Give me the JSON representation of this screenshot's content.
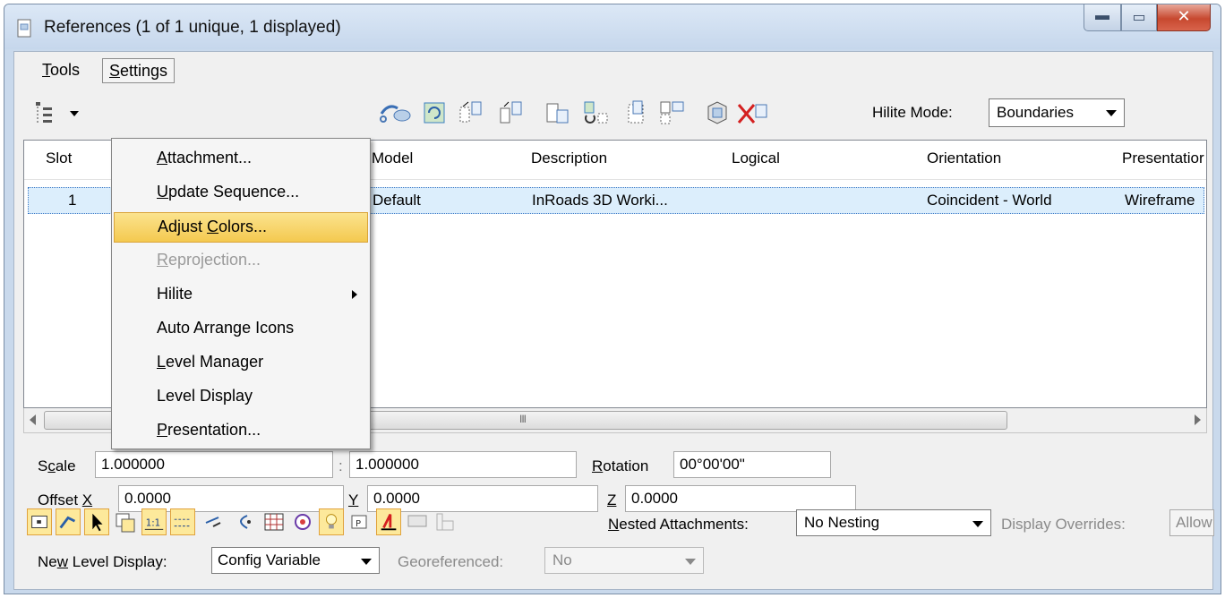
{
  "window": {
    "title": "References (1 of 1 unique, 1 displayed)"
  },
  "menubar": {
    "tools": "Tools",
    "settings": "Settings"
  },
  "settings_menu": {
    "items": [
      {
        "label": "Attachment...",
        "state": "normal"
      },
      {
        "label": "Update Sequence...",
        "state": "normal"
      },
      {
        "label": "Adjust Colors...",
        "state": "highlighted"
      },
      {
        "label": "Reprojection...",
        "state": "disabled"
      },
      {
        "label": "Hilite",
        "state": "submenu"
      },
      {
        "label": "Auto Arrange Icons",
        "state": "normal"
      },
      {
        "label": "Level Manager",
        "state": "normal"
      },
      {
        "label": "Level Display",
        "state": "normal"
      },
      {
        "label": "Presentation...",
        "state": "normal"
      }
    ]
  },
  "toolbar": {
    "hilite_label": "Hilite Mode:",
    "hilite_value": "Boundaries",
    "icons": [
      "reload-icon",
      "rotate-icon",
      "move-icon",
      "copy-icon",
      "scale-icon",
      "mirror-icon",
      "clip-icon",
      "clip-mask-icon",
      "clip-front-icon",
      "delete-clip-icon",
      "detach-icon"
    ]
  },
  "grid": {
    "columns": [
      "Slot",
      "Model",
      "Description",
      "Logical",
      "Orientation",
      "Presentatior"
    ],
    "rows": [
      {
        "slot": "1",
        "model": "Default",
        "description": "InRoads 3D Worki...",
        "logical": "",
        "orientation": "Coincident - World",
        "presentation": "Wireframe"
      }
    ]
  },
  "scrollbar": {
    "grip": "III"
  },
  "settings": {
    "scale_label": "Scale",
    "scale_a": "1.000000",
    "scale_sep": ":",
    "scale_b": "1.000000",
    "rotation_label": "Rotation",
    "rotation_value": "00°00'00\"",
    "offset_x_label": "Offset X",
    "offset_x_value": "0.0000",
    "offset_y_label": "Y",
    "offset_y_value": "0.0000",
    "offset_z_label": "Z",
    "offset_z_value": "0.0000"
  },
  "bottom": {
    "nested_label": "Nested Attachments:",
    "nested_value": "No Nesting",
    "display_overrides_label": "Display Overrides:",
    "display_overrides_value": "Allow",
    "new_level_display_label": "New Level Display:",
    "new_level_display_value": "Config Variable",
    "georeferenced_label": "Georeferenced:",
    "georeferenced_value": "No"
  },
  "colors": {
    "highlight": "#f4c94f",
    "toggle_on": "#fde99b",
    "selected_row": "#dceefc"
  }
}
